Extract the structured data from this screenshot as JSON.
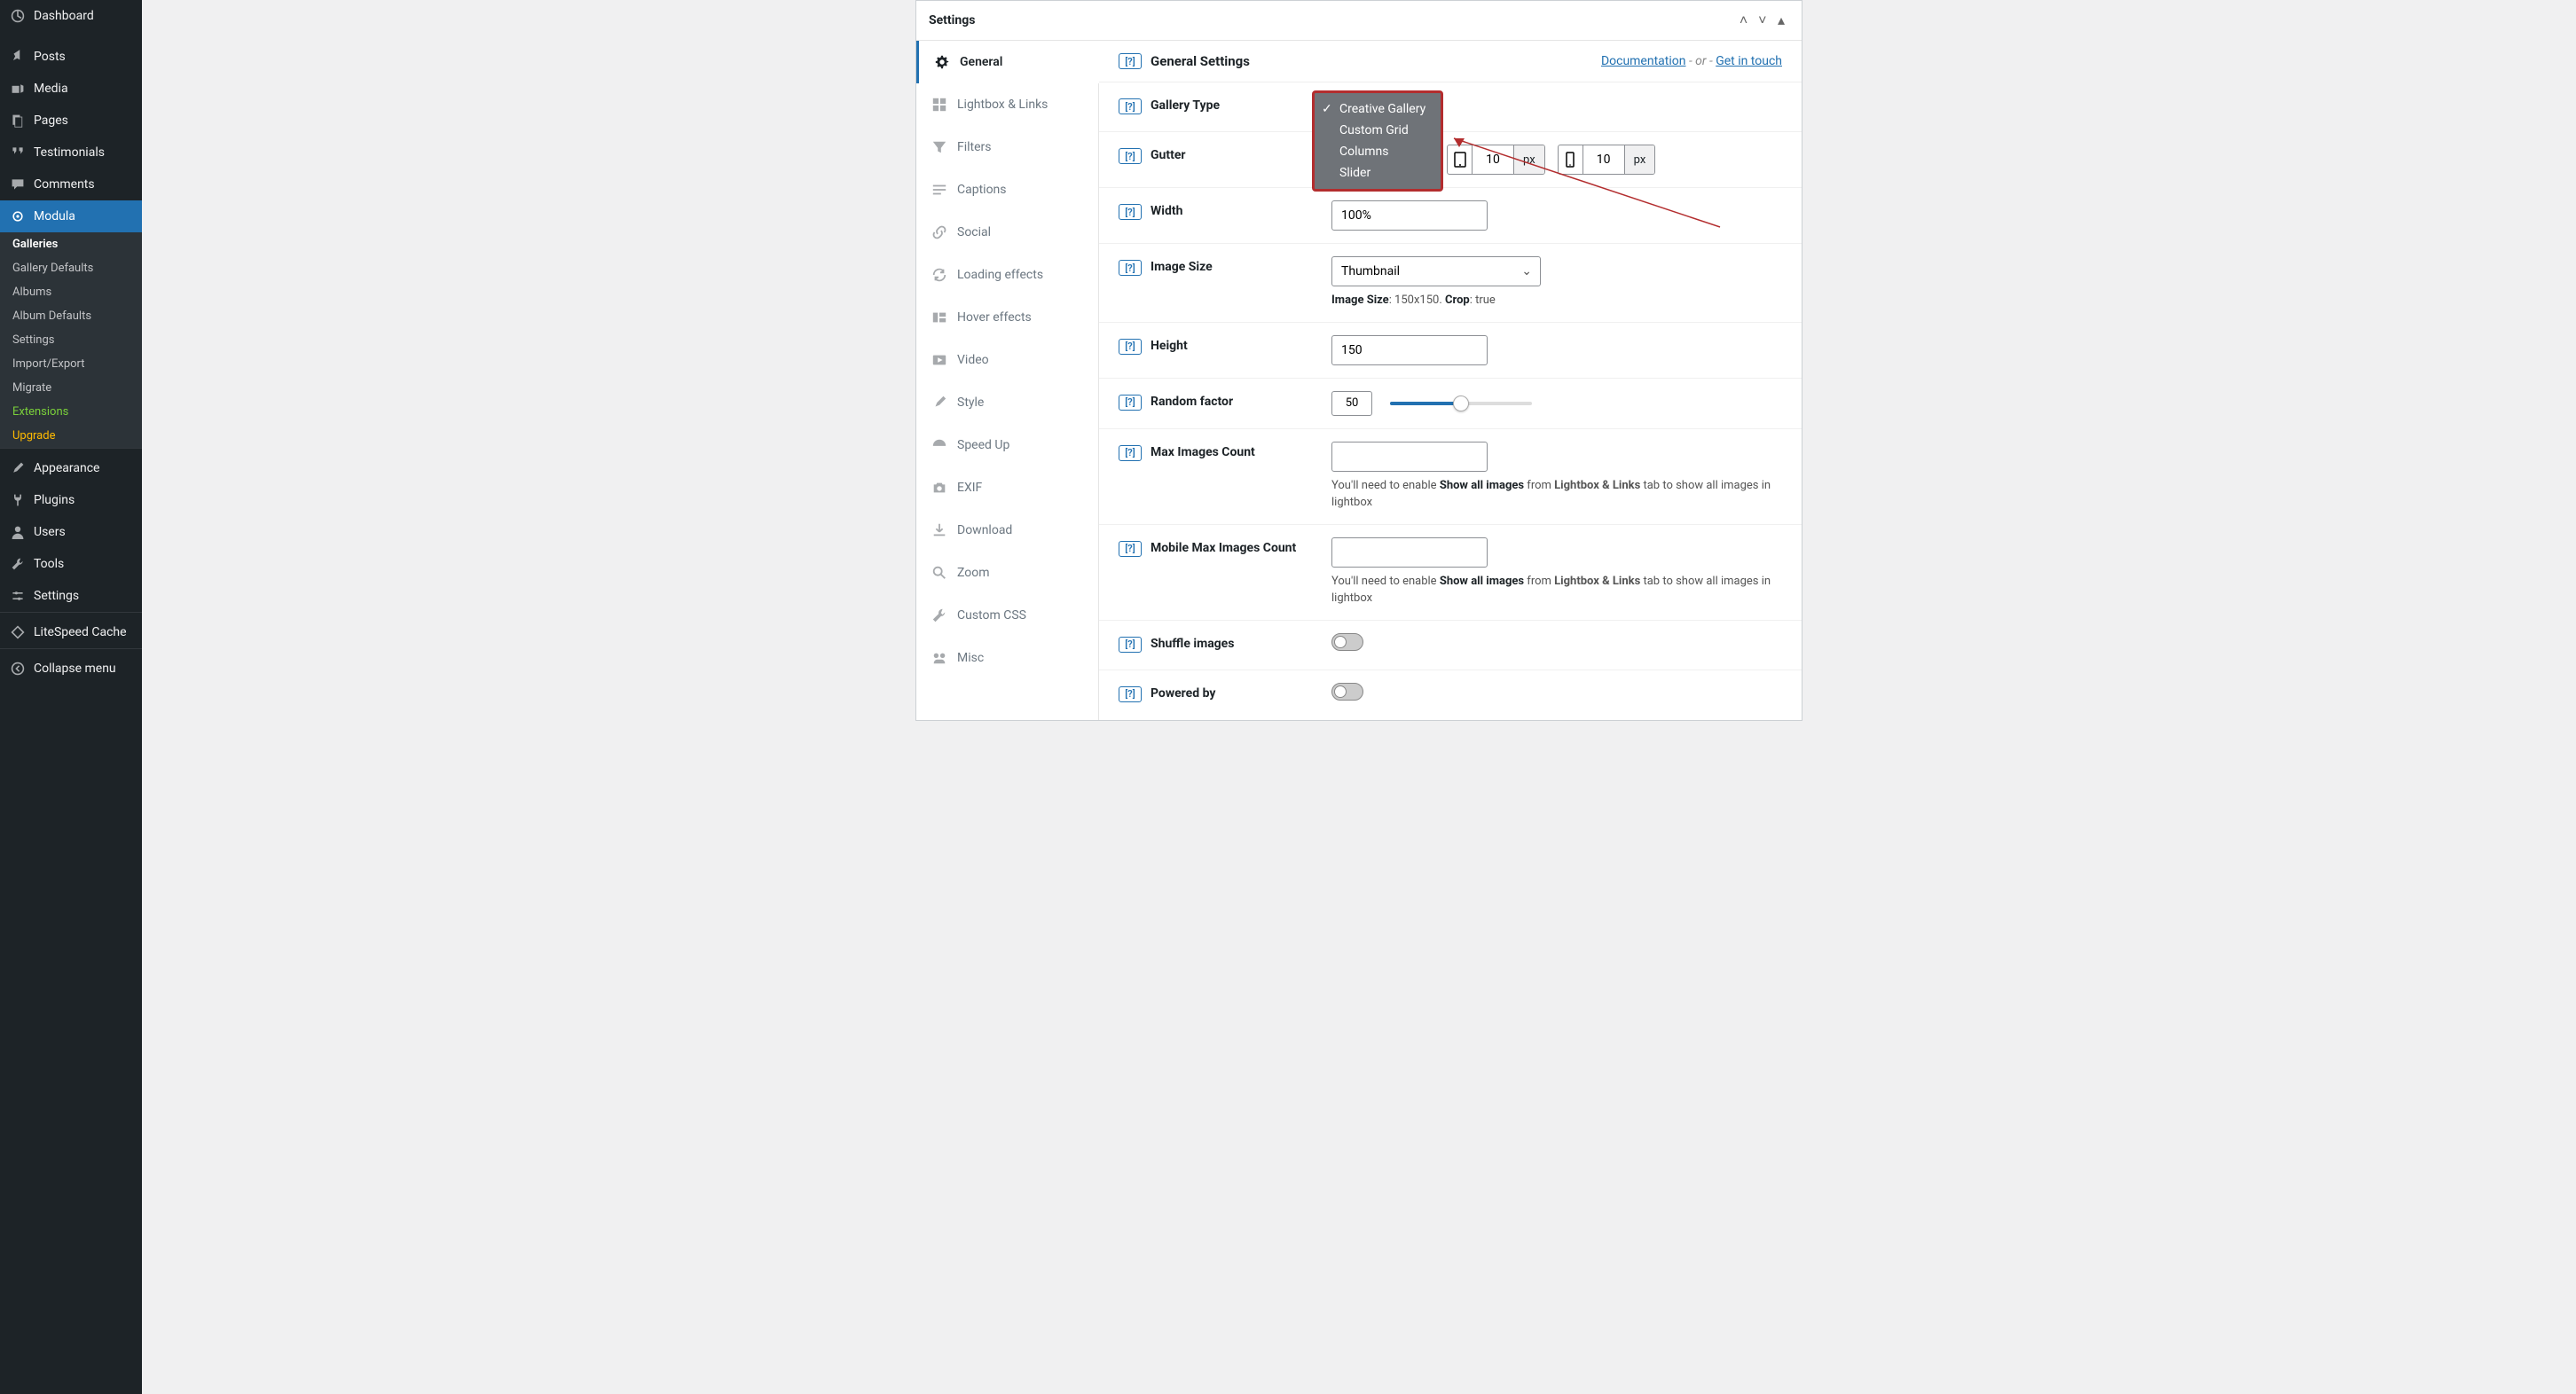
{
  "wp_menu": {
    "dashboard": "Dashboard",
    "posts": "Posts",
    "media": "Media",
    "pages": "Pages",
    "testimonials": "Testimonials",
    "comments": "Comments",
    "modula": "Modula",
    "appearance": "Appearance",
    "plugins": "Plugins",
    "users": "Users",
    "tools": "Tools",
    "settings": "Settings",
    "litespeed": "LiteSpeed Cache",
    "collapse": "Collapse menu"
  },
  "modula_sub": {
    "galleries": "Galleries",
    "gallery_defaults": "Gallery Defaults",
    "albums": "Albums",
    "album_defaults": "Album Defaults",
    "settings": "Settings",
    "import_export": "Import/Export",
    "migrate": "Migrate",
    "extensions": "Extensions",
    "upgrade": "Upgrade"
  },
  "panel": {
    "title": "Settings"
  },
  "tabs": {
    "general": "General",
    "lightbox": "Lightbox & Links",
    "filters": "Filters",
    "captions": "Captions",
    "social": "Social",
    "loading": "Loading effects",
    "hover": "Hover effects",
    "video": "Video",
    "style": "Style",
    "speedup": "Speed Up",
    "exif": "EXIF",
    "download": "Download",
    "zoom": "Zoom",
    "customcss": "Custom CSS",
    "misc": "Misc"
  },
  "content_head": {
    "title": "General Settings",
    "doc": "Documentation",
    "or": "- or -",
    "contact": "Get in touch"
  },
  "help": "[?]",
  "fields": {
    "gallery_type": {
      "label": "Gallery Type"
    },
    "gutter": {
      "label": "Gutter",
      "tablet": "10",
      "tablet_unit": "px",
      "mobile": "10",
      "mobile_unit": "px"
    },
    "width": {
      "label": "Width",
      "value": "100%"
    },
    "image_size": {
      "label": "Image Size",
      "value": "Thumbnail",
      "hint_pre": "Image Size",
      "hint_dim": ": 150x150. ",
      "hint_crop": "Crop",
      "hint_val": ": true"
    },
    "height": {
      "label": "Height",
      "value": "150"
    },
    "random": {
      "label": "Random factor",
      "value": "50"
    },
    "max_images": {
      "label": "Max Images Count",
      "hint1": "You'll need to enable ",
      "hint2": "Show all images",
      "hint3": " from ",
      "hint4": "Lightbox & Links",
      "hint5": " tab to show all images in lightbox"
    },
    "mobile_max": {
      "label": "Mobile Max Images Count"
    },
    "shuffle": {
      "label": "Shuffle images"
    },
    "powered": {
      "label": "Powered by"
    }
  },
  "dropdown": {
    "o1": "Creative Gallery",
    "o2": "Custom Grid",
    "o3": "Columns",
    "o4": "Slider"
  }
}
